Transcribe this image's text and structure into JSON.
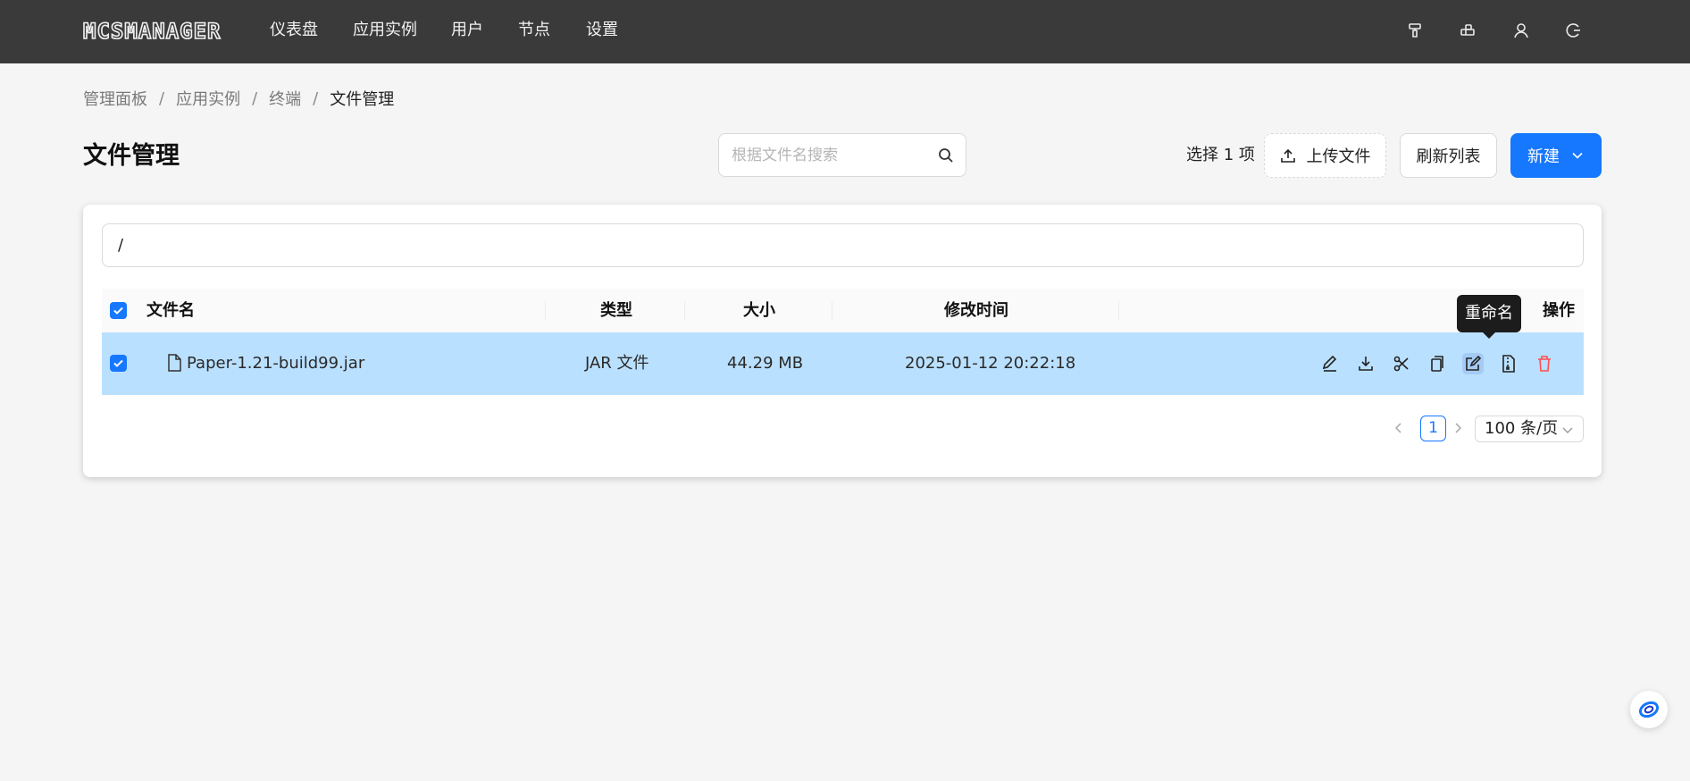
{
  "app": {
    "logo_text": "MCSMANAGER"
  },
  "nav": {
    "items": [
      {
        "label": "仪表盘"
      },
      {
        "label": "应用实例"
      },
      {
        "label": "用户"
      },
      {
        "label": "节点"
      },
      {
        "label": "设置"
      }
    ],
    "right_icons": [
      "paint-brush-icon",
      "layout-icon",
      "user-icon",
      "logout-icon"
    ]
  },
  "breadcrumb": {
    "items": [
      "管理面板",
      "应用实例",
      "终端",
      "文件管理"
    ],
    "separator": "/"
  },
  "header": {
    "title": "文件管理",
    "search_placeholder": "根据文件名搜索",
    "selected_text": "选择 1 项",
    "upload_label": "上传文件",
    "refresh_label": "刷新列表",
    "new_label": "新建"
  },
  "path": {
    "value": "/"
  },
  "table": {
    "columns": {
      "name": "文件名",
      "type": "类型",
      "size": "大小",
      "modified": "修改时间",
      "actions": "操作"
    },
    "rows": [
      {
        "name": "Paper-1.21-build99.jar",
        "type": "JAR 文件",
        "size": "44.29 MB",
        "modified": "2025-01-12 20:22:18",
        "selected": true
      }
    ],
    "row_actions": [
      "edit-icon",
      "download-icon",
      "cut-icon",
      "copy-icon",
      "rename-icon",
      "compress-icon",
      "delete-icon"
    ]
  },
  "tooltip": {
    "text": "重命名"
  },
  "pagination": {
    "current_page": "1",
    "page_size": "100 条/页"
  },
  "colors": {
    "primary": "#1677ff",
    "topbar": "#3a3a3a",
    "selected_row": "#bae0ff",
    "danger": "#ff4d4f"
  }
}
